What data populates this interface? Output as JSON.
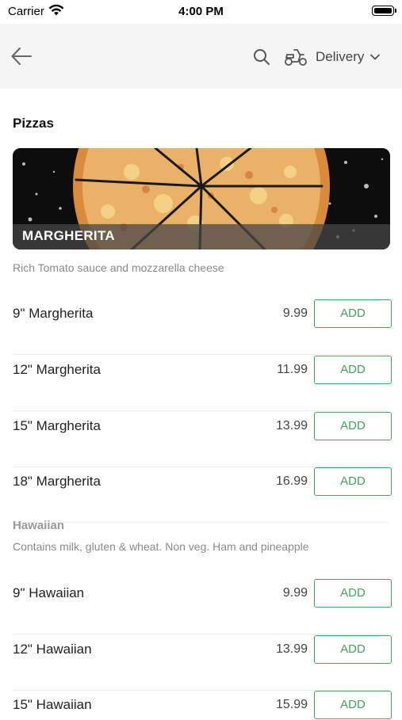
{
  "status_bar": {
    "carrier": "Carrier",
    "time": "4:00 PM"
  },
  "nav": {
    "delivery_label": "Delivery"
  },
  "section": {
    "title": "Pizzas"
  },
  "margherita": {
    "banner_title": "MARGHERITA",
    "description": "Rich Tomato sauce and mozzarella cheese",
    "items": [
      {
        "name": "9\" Margherita",
        "price": "9.99",
        "action": "ADD"
      },
      {
        "name": "12\" Margherita",
        "price": "11.99",
        "action": "ADD"
      },
      {
        "name": "15\" Margherita",
        "price": "13.99",
        "action": "ADD"
      },
      {
        "name": "18\" Margherita",
        "price": "16.99",
        "action": "ADD"
      }
    ]
  },
  "hawaiian": {
    "title": "Hawaiian",
    "description": "Contains milk, gluten & wheat. Non veg. Ham and pineapple",
    "items": [
      {
        "name": "9\" Hawaiian",
        "price": "9.99",
        "action": "ADD"
      },
      {
        "name": "12\" Hawaiian",
        "price": "13.99",
        "action": "ADD"
      },
      {
        "name": "15\" Hawaiian",
        "price": "15.99",
        "action": "ADD"
      }
    ]
  },
  "colors": {
    "accent": "#43a35e",
    "nav_background": "#f5f5f5",
    "muted_text": "#8a8a8a"
  }
}
